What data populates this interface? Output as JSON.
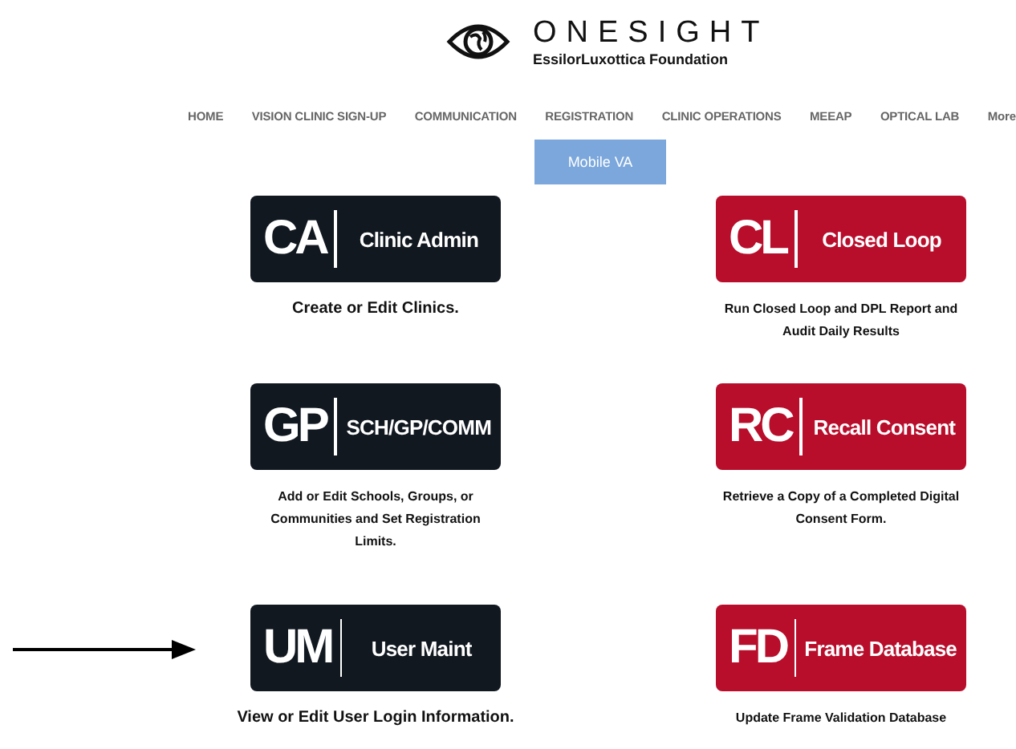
{
  "brand": {
    "name": "ONESIGHT",
    "tagline": "EssilorLuxottica Foundation"
  },
  "nav": [
    {
      "label": "HOME"
    },
    {
      "label": "VISION CLINIC SIGN-UP"
    },
    {
      "label": "COMMUNICATION"
    },
    {
      "label": "REGISTRATION"
    },
    {
      "label": "CLINIC OPERATIONS"
    },
    {
      "label": "MEEAP"
    },
    {
      "label": "OPTICAL LAB"
    },
    {
      "label": "More"
    }
  ],
  "submenu": [
    {
      "label": "Mobile VA"
    }
  ],
  "tiles": [
    {
      "code": "CA",
      "title": "Clinic Admin",
      "description": "Create or Edit Clinics.",
      "color": "#111820",
      "pointed": false
    },
    {
      "code": "CL",
      "title": "Closed Loop",
      "description": "Run Closed Loop and DPL Report and Audit Daily Results",
      "color": "#b80d2b",
      "pointed": false
    },
    {
      "code": "GP",
      "title": "SCH/GP/COMM",
      "description": "Add or Edit Schools, Groups, or Communities and Set Registration Limits.",
      "color": "#111820",
      "pointed": false
    },
    {
      "code": "RC",
      "title": "Recall Consent",
      "description": "Retrieve a Copy of a Completed Digital Consent Form.",
      "color": "#b80d2b",
      "pointed": false
    },
    {
      "code": "UM",
      "title": "User Maint",
      "description": "View or Edit User Login Information.",
      "color": "#111820",
      "pointed": true
    },
    {
      "code": "FD",
      "title": "Frame Database",
      "description": "Update Frame Validation Database",
      "color": "#b80d2b",
      "pointed": false
    }
  ]
}
